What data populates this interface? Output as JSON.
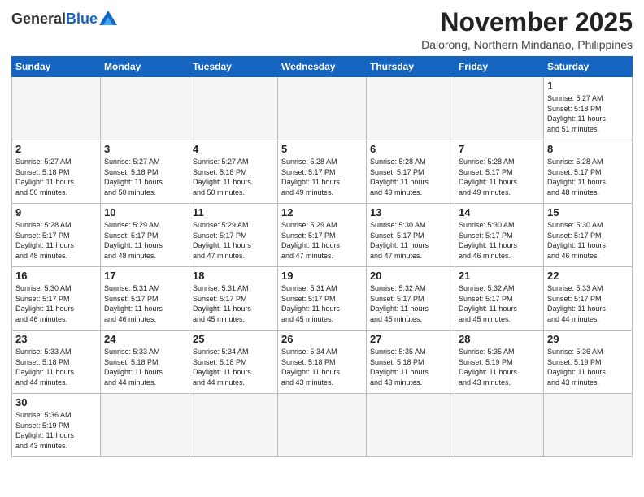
{
  "header": {
    "logo_general": "General",
    "logo_blue": "Blue",
    "month_title": "November 2025",
    "location": "Dalorong, Northern Mindanao, Philippines"
  },
  "weekdays": [
    "Sunday",
    "Monday",
    "Tuesday",
    "Wednesday",
    "Thursday",
    "Friday",
    "Saturday"
  ],
  "weeks": [
    [
      {
        "day": "",
        "info": ""
      },
      {
        "day": "",
        "info": ""
      },
      {
        "day": "",
        "info": ""
      },
      {
        "day": "",
        "info": ""
      },
      {
        "day": "",
        "info": ""
      },
      {
        "day": "",
        "info": ""
      },
      {
        "day": "1",
        "info": "Sunrise: 5:27 AM\nSunset: 5:18 PM\nDaylight: 11 hours\nand 51 minutes."
      }
    ],
    [
      {
        "day": "2",
        "info": "Sunrise: 5:27 AM\nSunset: 5:18 PM\nDaylight: 11 hours\nand 50 minutes."
      },
      {
        "day": "3",
        "info": "Sunrise: 5:27 AM\nSunset: 5:18 PM\nDaylight: 11 hours\nand 50 minutes."
      },
      {
        "day": "4",
        "info": "Sunrise: 5:27 AM\nSunset: 5:18 PM\nDaylight: 11 hours\nand 50 minutes."
      },
      {
        "day": "5",
        "info": "Sunrise: 5:28 AM\nSunset: 5:17 PM\nDaylight: 11 hours\nand 49 minutes."
      },
      {
        "day": "6",
        "info": "Sunrise: 5:28 AM\nSunset: 5:17 PM\nDaylight: 11 hours\nand 49 minutes."
      },
      {
        "day": "7",
        "info": "Sunrise: 5:28 AM\nSunset: 5:17 PM\nDaylight: 11 hours\nand 49 minutes."
      },
      {
        "day": "8",
        "info": "Sunrise: 5:28 AM\nSunset: 5:17 PM\nDaylight: 11 hours\nand 48 minutes."
      }
    ],
    [
      {
        "day": "9",
        "info": "Sunrise: 5:28 AM\nSunset: 5:17 PM\nDaylight: 11 hours\nand 48 minutes."
      },
      {
        "day": "10",
        "info": "Sunrise: 5:29 AM\nSunset: 5:17 PM\nDaylight: 11 hours\nand 48 minutes."
      },
      {
        "day": "11",
        "info": "Sunrise: 5:29 AM\nSunset: 5:17 PM\nDaylight: 11 hours\nand 47 minutes."
      },
      {
        "day": "12",
        "info": "Sunrise: 5:29 AM\nSunset: 5:17 PM\nDaylight: 11 hours\nand 47 minutes."
      },
      {
        "day": "13",
        "info": "Sunrise: 5:30 AM\nSunset: 5:17 PM\nDaylight: 11 hours\nand 47 minutes."
      },
      {
        "day": "14",
        "info": "Sunrise: 5:30 AM\nSunset: 5:17 PM\nDaylight: 11 hours\nand 46 minutes."
      },
      {
        "day": "15",
        "info": "Sunrise: 5:30 AM\nSunset: 5:17 PM\nDaylight: 11 hours\nand 46 minutes."
      }
    ],
    [
      {
        "day": "16",
        "info": "Sunrise: 5:30 AM\nSunset: 5:17 PM\nDaylight: 11 hours\nand 46 minutes."
      },
      {
        "day": "17",
        "info": "Sunrise: 5:31 AM\nSunset: 5:17 PM\nDaylight: 11 hours\nand 46 minutes."
      },
      {
        "day": "18",
        "info": "Sunrise: 5:31 AM\nSunset: 5:17 PM\nDaylight: 11 hours\nand 45 minutes."
      },
      {
        "day": "19",
        "info": "Sunrise: 5:31 AM\nSunset: 5:17 PM\nDaylight: 11 hours\nand 45 minutes."
      },
      {
        "day": "20",
        "info": "Sunrise: 5:32 AM\nSunset: 5:17 PM\nDaylight: 11 hours\nand 45 minutes."
      },
      {
        "day": "21",
        "info": "Sunrise: 5:32 AM\nSunset: 5:17 PM\nDaylight: 11 hours\nand 45 minutes."
      },
      {
        "day": "22",
        "info": "Sunrise: 5:33 AM\nSunset: 5:17 PM\nDaylight: 11 hours\nand 44 minutes."
      }
    ],
    [
      {
        "day": "23",
        "info": "Sunrise: 5:33 AM\nSunset: 5:18 PM\nDaylight: 11 hours\nand 44 minutes."
      },
      {
        "day": "24",
        "info": "Sunrise: 5:33 AM\nSunset: 5:18 PM\nDaylight: 11 hours\nand 44 minutes."
      },
      {
        "day": "25",
        "info": "Sunrise: 5:34 AM\nSunset: 5:18 PM\nDaylight: 11 hours\nand 44 minutes."
      },
      {
        "day": "26",
        "info": "Sunrise: 5:34 AM\nSunset: 5:18 PM\nDaylight: 11 hours\nand 43 minutes."
      },
      {
        "day": "27",
        "info": "Sunrise: 5:35 AM\nSunset: 5:18 PM\nDaylight: 11 hours\nand 43 minutes."
      },
      {
        "day": "28",
        "info": "Sunrise: 5:35 AM\nSunset: 5:19 PM\nDaylight: 11 hours\nand 43 minutes."
      },
      {
        "day": "29",
        "info": "Sunrise: 5:36 AM\nSunset: 5:19 PM\nDaylight: 11 hours\nand 43 minutes."
      }
    ],
    [
      {
        "day": "30",
        "info": "Sunrise: 5:36 AM\nSunset: 5:19 PM\nDaylight: 11 hours\nand 43 minutes."
      },
      {
        "day": "",
        "info": ""
      },
      {
        "day": "",
        "info": ""
      },
      {
        "day": "",
        "info": ""
      },
      {
        "day": "",
        "info": ""
      },
      {
        "day": "",
        "info": ""
      },
      {
        "day": "",
        "info": ""
      }
    ]
  ]
}
